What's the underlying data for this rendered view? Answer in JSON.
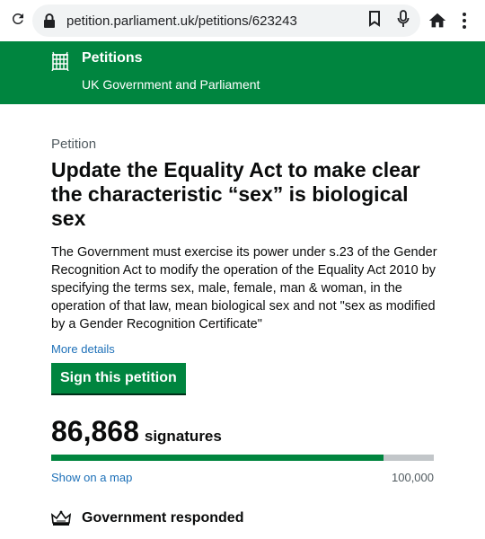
{
  "browser": {
    "url": "petition.parliament.uk/petitions/623243",
    "icons": [
      "reload-icon",
      "lock-icon",
      "bookmark-icon",
      "microphone-icon",
      "home-icon",
      "more-vert-icon"
    ]
  },
  "header": {
    "title": "Petitions",
    "subtitle": "UK Government and Parliament",
    "logo": "portcullis-icon",
    "brand_color": "#00853f"
  },
  "petition": {
    "caption": "Petition",
    "title": "Update the Equality Act to make clear the characteristic “sex” is biological sex",
    "description": "The Government must exercise its power under s.23 of the Gender Recognition Act to modify the operation of the Equality Act 2010 by specifying the terms sex, male, female, man & woman, in the operation of that law, mean biological sex and not \"sex as modified by a Gender Recognition Certificate\"",
    "more_details": "More details",
    "sign_button": "Sign this petition",
    "signature_count": "86,868",
    "signature_label": "signatures",
    "progress_fraction": 0.86868,
    "show_map": "Show on a map",
    "threshold": "100,000",
    "response_label": "Government responded",
    "response_icon": "crown-icon"
  },
  "colors": {
    "link": "#1d70b8",
    "progress_track": "#c2c6c9"
  }
}
